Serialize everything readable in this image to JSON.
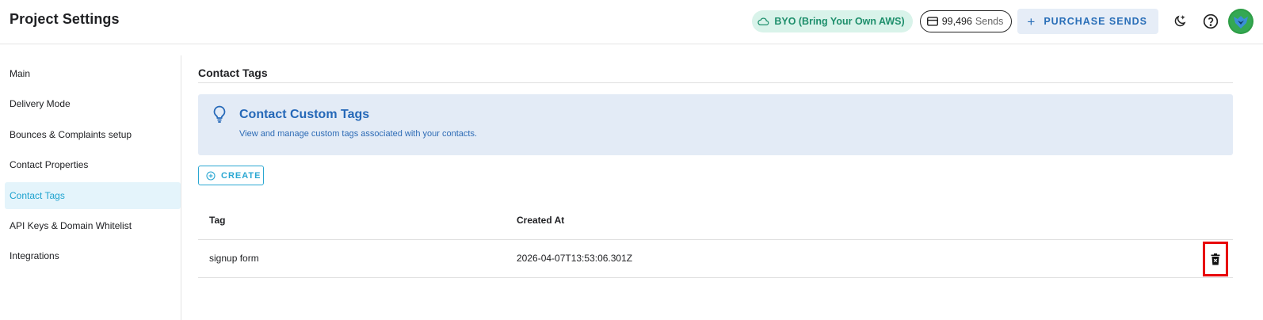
{
  "header": {
    "title": "Project Settings",
    "byo_badge": "BYO (Bring Your Own AWS)",
    "sends_count": "99,496",
    "sends_label": "Sends",
    "purchase_label": "PURCHASE SENDS"
  },
  "sidebar": {
    "items": [
      {
        "label": "Main"
      },
      {
        "label": "Delivery Mode"
      },
      {
        "label": "Bounces & Complaints setup"
      },
      {
        "label": "Contact Properties"
      },
      {
        "label": "Contact Tags",
        "active": true
      },
      {
        "label": "API Keys & Domain Whitelist"
      },
      {
        "label": "Integrations"
      }
    ]
  },
  "main": {
    "section_title": "Contact Tags",
    "info": {
      "title": "Contact Custom Tags",
      "description": "View and manage custom tags associated with your contacts."
    },
    "create_label": "CREATE",
    "table": {
      "headers": [
        "Tag",
        "Created At"
      ],
      "rows": [
        {
          "tag": "signup form",
          "created_at": "2026-04-07T13:53:06.301Z"
        }
      ]
    }
  },
  "colors": {
    "accent": "#1ea3cf",
    "info_blue": "#2568b8",
    "byo_green": "#1e8f6c",
    "highlight_red": "#e8000a"
  },
  "icons": [
    "cloud-icon",
    "credit-card-icon",
    "plus-icon",
    "moon-icon",
    "help-icon",
    "avatar-icon",
    "lightbulb-icon",
    "add-circle-icon",
    "trash-icon"
  ]
}
